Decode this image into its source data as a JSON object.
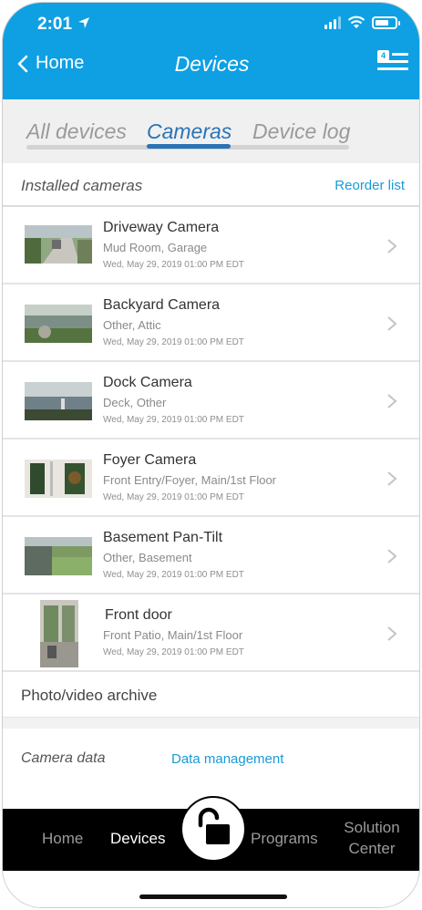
{
  "status_bar": {
    "time": "2:01"
  },
  "header": {
    "back_label": "Home",
    "title": "Devices",
    "badge_count": "4"
  },
  "tabs": [
    {
      "label": "All devices"
    },
    {
      "label": "Cameras"
    },
    {
      "label": "Device log"
    }
  ],
  "installed": {
    "title": "Installed cameras",
    "reorder_label": "Reorder list"
  },
  "cameras": [
    {
      "name": "Driveway Camera",
      "location": "Mud Room, Garage",
      "timestamp": "Wed, May 29, 2019 01:00 PM EDT"
    },
    {
      "name": "Backyard Camera",
      "location": "Other, Attic",
      "timestamp": "Wed, May 29, 2019 01:00 PM EDT"
    },
    {
      "name": "Dock Camera",
      "location": "Deck, Other",
      "timestamp": "Wed, May 29, 2019 01:00 PM EDT"
    },
    {
      "name": "Foyer Camera",
      "location": "Front Entry/Foyer, Main/1st Floor",
      "timestamp": "Wed, May 29, 2019 01:00 PM EDT"
    },
    {
      "name": "Basement Pan-Tilt",
      "location": "Other, Basement",
      "timestamp": "Wed, May 29, 2019 01:00 PM EDT"
    },
    {
      "name": "Front door",
      "location": "Front Patio, Main/1st Floor",
      "timestamp": "Wed, May 29, 2019 01:00 PM EDT"
    }
  ],
  "archive": {
    "label": "Photo/video archive"
  },
  "camera_data": {
    "label": "Camera data",
    "link": "Data management"
  },
  "bottom_nav": {
    "home": "Home",
    "devices": "Devices",
    "programs": "Programs",
    "solution_line1": "Solution",
    "solution_line2": "Center"
  },
  "colors": {
    "brand": "#0ea0e3",
    "link": "#1b9ad6",
    "active_tab": "#2a73b5"
  }
}
